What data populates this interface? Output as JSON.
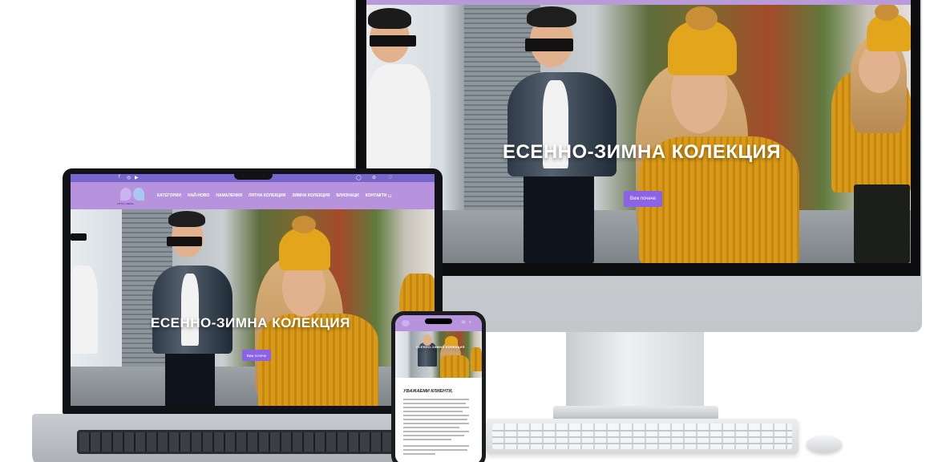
{
  "site": {
    "logo_text": "LITTLE ANGEL",
    "hero_title": "ЕСЕННО-ЗИМНА КОЛЕКЦИЯ",
    "hero_button": "Виж почече",
    "nav_items": [
      "КАТЕГОРИИ",
      "НАЙ-НОВО",
      "НАМАЛЕНИЯ",
      "ЛЯТНА КОЛЕКЦИЯ",
      "ЗИМНА КОЛЕКЦИЯ",
      "БЛИЗНАЦИ",
      "КОНТАКТИ"
    ],
    "top_labels": [
      "ВХОД",
      "УП.ВЪТРЕЩАН",
      "ЛЮБИМИ"
    ],
    "mobile_heading": "УВАЖАЕМИ КЛИЕНТИ,"
  },
  "colors": {
    "nav_purple": "#b893dd",
    "top_strip": "#7766cc",
    "button": "#8a63e6",
    "sweater": "#d99a18"
  },
  "icons": [
    "facebook-icon",
    "instagram-icon",
    "youtube-icon",
    "user-icon",
    "cart-icon",
    "heart-icon",
    "search-icon",
    "phone-icon"
  ]
}
